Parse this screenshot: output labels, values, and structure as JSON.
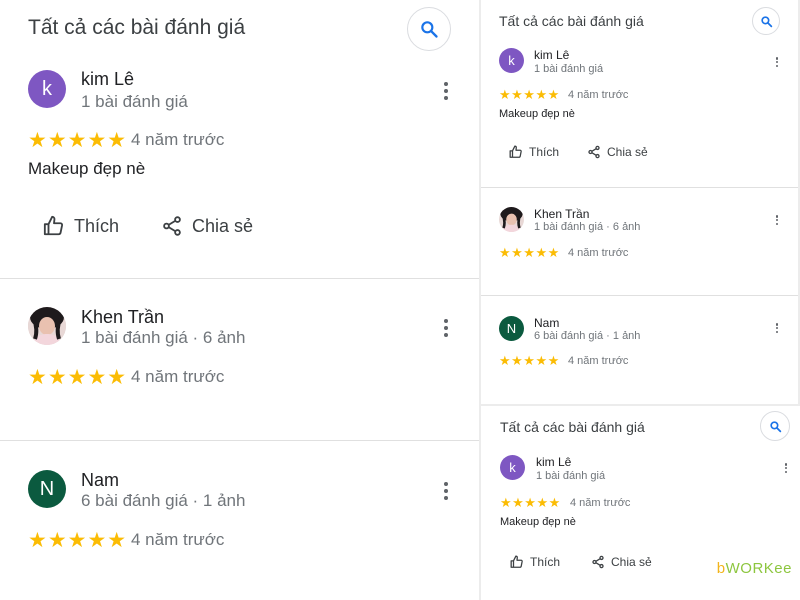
{
  "colors": {
    "star": "#fbbc04",
    "search_icon": "#1a73e8",
    "avatar_kim": "#7e57c2",
    "avatar_nam": "#0b5a3f",
    "watermark_b": "#f2b51c",
    "watermark_rest": "#8dc63f"
  },
  "left": {
    "title": "Tất cả các bài đánh giá",
    "reviews": [
      {
        "initial": "k",
        "name": "kim Lê",
        "meta": "1 bài đánh giá",
        "stars": "★★★★★",
        "rating": 5,
        "time": "4 năm trước",
        "text": "Makeup đẹp nè",
        "like_label": "Thích",
        "share_label": "Chia sẻ"
      },
      {
        "name": "Khen Trần",
        "meta": "1 bài đánh giá · 6 ảnh",
        "stars": "★★★★★",
        "rating": 5,
        "time": "4 năm trước"
      },
      {
        "initial": "N",
        "name": "Nam",
        "meta": "6 bài đánh giá · 1 ảnh",
        "stars": "★★★★★",
        "rating": 5,
        "time": "4 năm trước"
      }
    ]
  },
  "right_top": {
    "title": "Tất cả các bài đánh giá",
    "reviews": [
      {
        "initial": "k",
        "name": "kim Lê",
        "meta": "1 bài đánh giá",
        "stars": "★★★★★",
        "rating": 5,
        "time": "4 năm trước",
        "text": "Makeup đẹp nè",
        "like_label": "Thích",
        "share_label": "Chia sẻ"
      },
      {
        "name": "Khen Trần",
        "meta": "1 bài đánh giá · 6 ảnh",
        "stars": "★★★★★",
        "rating": 5,
        "time": "4 năm trước"
      },
      {
        "initial": "N",
        "name": "Nam",
        "meta": "6 bài đánh giá · 1 ảnh",
        "stars": "★★★★★",
        "rating": 5,
        "time": "4 năm trước"
      }
    ]
  },
  "right_bottom": {
    "title": "Tất cả các bài đánh giá",
    "reviews": [
      {
        "initial": "k",
        "name": "kim Lê",
        "meta": "1 bài đánh giá",
        "stars": "★★★★★",
        "rating": 5,
        "time": "4 năm trước",
        "text": "Makeup đẹp nè",
        "like_label": "Thích",
        "share_label": "Chia sẻ"
      }
    ]
  },
  "watermark": {
    "b": "b",
    "rest": "WORKee"
  }
}
